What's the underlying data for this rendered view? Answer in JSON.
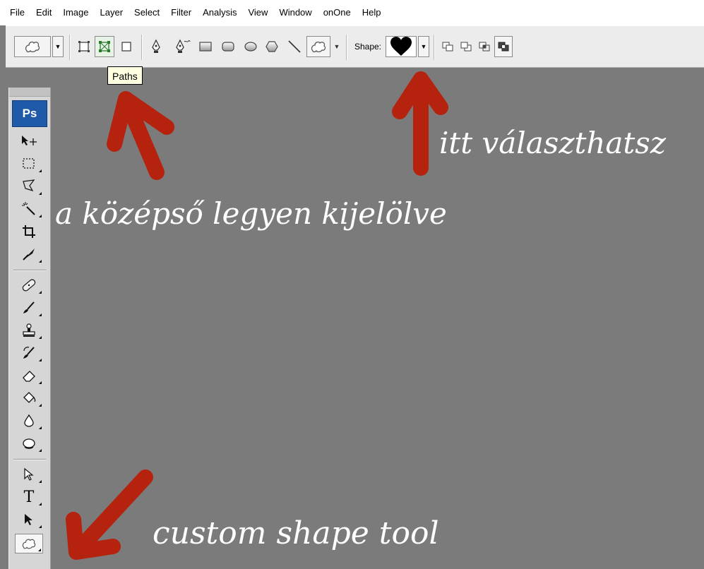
{
  "menu": {
    "items": [
      "File",
      "Edit",
      "Image",
      "Layer",
      "Select",
      "Filter",
      "Analysis",
      "View",
      "Window",
      "onOne",
      "Help"
    ]
  },
  "options_bar": {
    "shape_label": "Shape:",
    "tooltip": "Paths"
  },
  "toolbox": {
    "logo": "Ps",
    "type_tool_glyph": "T"
  },
  "annotations": {
    "middle_selected": "a középső legyen kijelölve",
    "choose_here": "itt választhatsz",
    "custom_shape_tool": "custom shape tool"
  },
  "colors": {
    "arrow": "#b5230f",
    "canvas": "#7b7b7b",
    "ps_blue": "#1f5aa8"
  },
  "icons": {
    "tool_preset": "custom-shape-icon",
    "shape_preview": "heart-icon"
  }
}
